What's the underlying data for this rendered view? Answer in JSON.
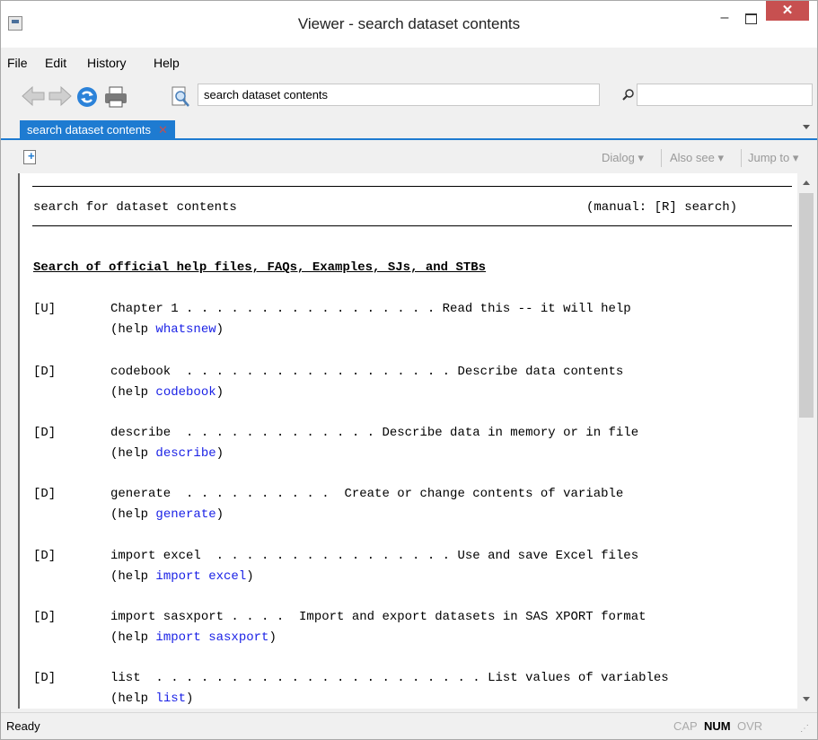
{
  "window": {
    "title": "Viewer - search dataset contents"
  },
  "menu": [
    "File",
    "Edit",
    "History",
    "Help"
  ],
  "toolbar": {
    "address_value": "search dataset contents"
  },
  "tab": {
    "label": "search dataset contents",
    "close": "✕"
  },
  "viewer_toolbar": {
    "dialog": "Dialog ▾",
    "also_see": "Also see ▾",
    "jump_to": "Jump to ▾"
  },
  "doc": {
    "title": "search for dataset contents",
    "manual": "(manual:  [R] search)",
    "section_heading": "Search of official help files, FAQs, Examples, SJs, and STBs",
    "help_prefix": "(help ",
    "help_suffix": ")",
    "entries": [
      {
        "tag": "[U]",
        "line": "Chapter 1 . . . . . . . . . . . . . . . . . Read this -- it will help",
        "link": "whatsnew"
      },
      {
        "tag": "[D]",
        "line": "codebook  . . . . . . . . . . . . . . . . . . Describe data contents",
        "link": "codebook"
      },
      {
        "tag": "[D]",
        "line": "describe  . . . . . . . . . . . . . Describe data in memory or in file",
        "link": "describe"
      },
      {
        "tag": "[D]",
        "line": "generate  . . . . . . . . . .  Create or change contents of variable",
        "link": "generate"
      },
      {
        "tag": "[D]",
        "line": "import excel  . . . . . . . . . . . . . . . . Use and save Excel files",
        "link": "import excel"
      },
      {
        "tag": "[D]",
        "line": "import sasxport . . . .  Import and export datasets in SAS XPORT format",
        "link": "import sasxport"
      },
      {
        "tag": "[D]",
        "line": "list  . . . . . . . . . . . . . . . . . . . . . . List values of variables",
        "link": "list"
      }
    ]
  },
  "status": {
    "left": "Ready",
    "cap": "CAP",
    "num": "NUM",
    "ovr": "OVR"
  },
  "icons": [
    "back-arrow-icon",
    "forward-arrow-icon",
    "refresh-icon",
    "print-icon",
    "find-icon",
    "search-icon",
    "new-viewer-icon"
  ]
}
